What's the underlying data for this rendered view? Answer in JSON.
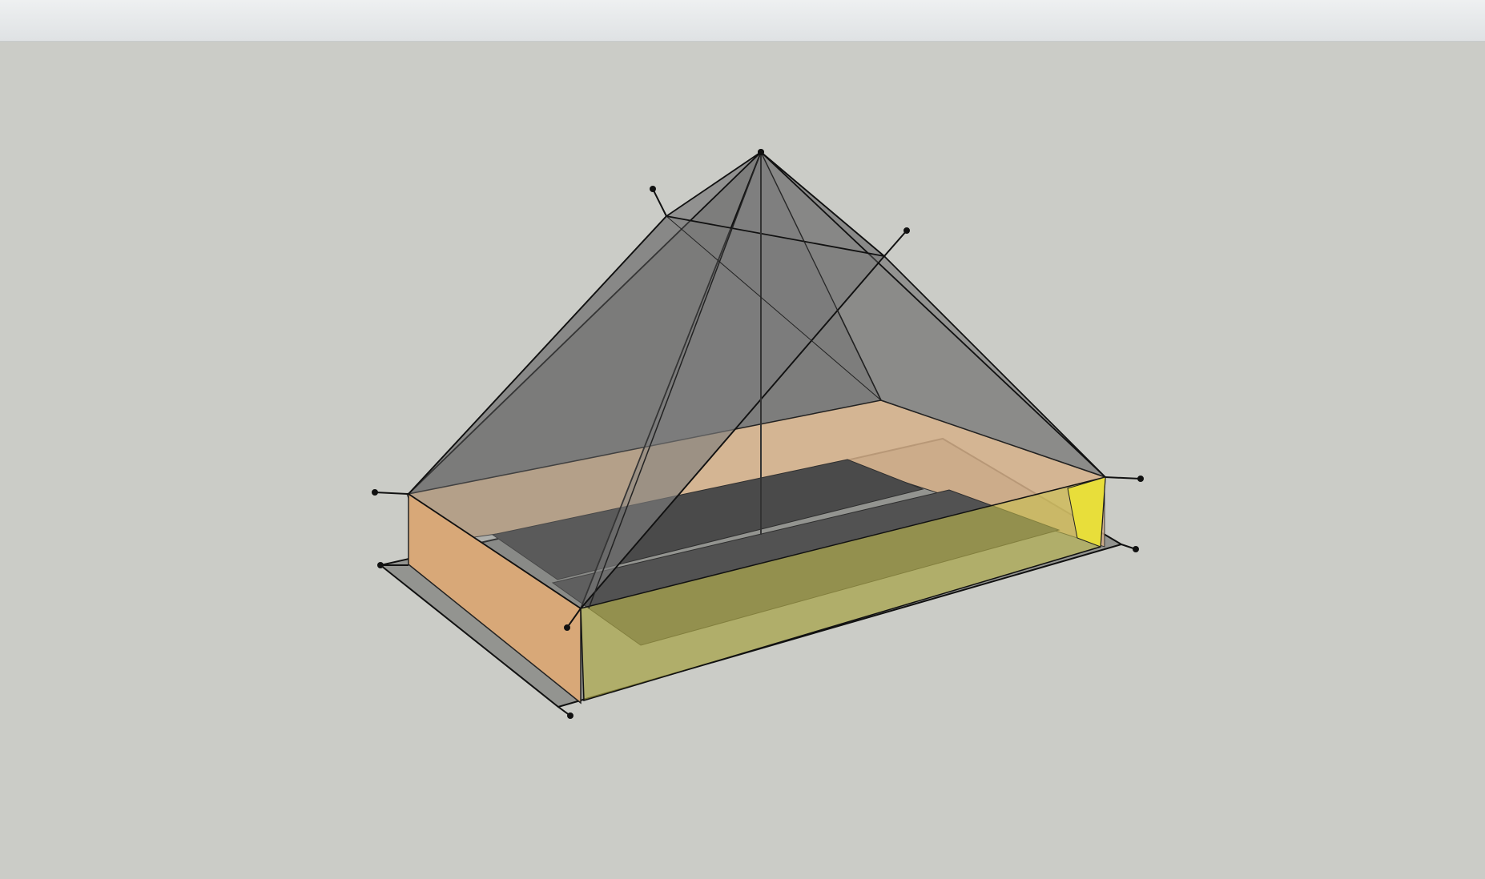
{
  "app": {
    "window_title": "",
    "toolbar_label": ""
  },
  "scene": {
    "object": "tent-model",
    "colors": {
      "background": "#cbccc7",
      "toolbar": "#e6e8ea",
      "canopy": "#6e6e6e",
      "bathtub_wall": "#d8a878",
      "highlight_wall": "#e8de3a",
      "sleeping_pads": "#4a4a4a",
      "edges": "#111111"
    },
    "icons": [
      "stake-icon",
      "pole-icon"
    ]
  }
}
